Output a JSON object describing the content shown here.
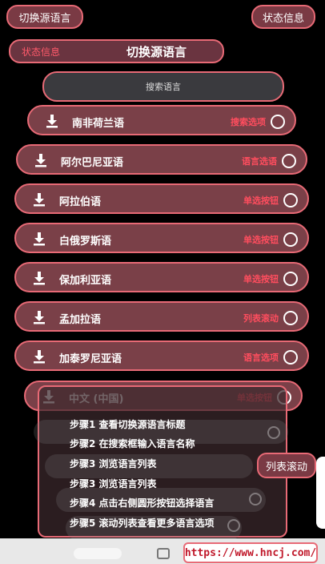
{
  "top_bar": {
    "left_button": "切换源语言",
    "right_button": "状态信息"
  },
  "header": {
    "status_label": "状态信息",
    "title": "切换源语言"
  },
  "search": {
    "placeholder": "搜索语言"
  },
  "languages": [
    {
      "name": "南非荷兰语",
      "tag": "搜索选项"
    },
    {
      "name": "阿尔巴尼亚语",
      "tag": "语言选语"
    },
    {
      "name": "阿拉伯语",
      "tag": "单选按钮"
    },
    {
      "name": "白俄罗斯语",
      "tag": "单选按钮"
    },
    {
      "name": "保加利亚语",
      "tag": "单选按钮"
    },
    {
      "name": "孟加拉语",
      "tag": "列表滚动"
    },
    {
      "name": "加泰罗尼亚语",
      "tag": "语言选项"
    },
    {
      "name": "中文 (中国)",
      "tag": "单选按钮"
    }
  ],
  "steps": [
    "步骤1 查看切换源语言标题",
    "步骤2 在搜索框输入语言名称",
    "步骤3 浏览语言列表",
    "步骤3 浏览语言列表",
    "步骤4 点击右侧圆形按钮选择语言",
    "步骤5 滚动列表查看更多语言选项"
  ],
  "scroll_button": "列表滚动",
  "watermark_url": "https://www.hncj.com/",
  "colors": {
    "accent": "#e86a76",
    "tag_red": "#ff4d5e",
    "row_bg": "#7a4048"
  }
}
